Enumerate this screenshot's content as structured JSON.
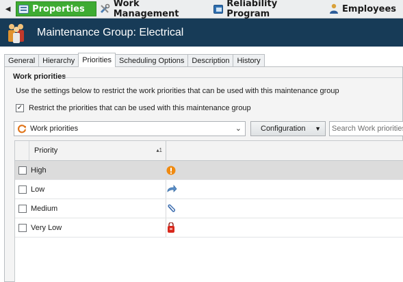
{
  "nav": {
    "items": [
      {
        "label": "Properties",
        "icon": "properties-icon",
        "active": true
      },
      {
        "label": "Work Management",
        "icon": "tools-icon"
      },
      {
        "label": "Reliability Program",
        "icon": "reliability-icon"
      },
      {
        "label": "Employees",
        "icon": "employee-icon"
      }
    ]
  },
  "header": {
    "title": "Maintenance Group: Electrical",
    "icon": "maintenance-group-icon"
  },
  "tabs": [
    "General",
    "Hierarchy",
    "Priorities",
    "Scheduling Options",
    "Description",
    "History"
  ],
  "active_tab": "Priorities",
  "section": {
    "title": "Work priorities",
    "description": "Use the settings below to restrict the work priorities that can be used with this maintenance group",
    "restrict_label": "Restrict the priorities that can be used with this maintenance group",
    "restrict_checked": true
  },
  "toolbar": {
    "view_value": "Work priorities",
    "configuration_label": "Configuration",
    "search_placeholder": "Search Work priorities"
  },
  "grid": {
    "column_header": "Priority",
    "sort_indicator": "1",
    "rows": [
      {
        "name": "High",
        "icon": "exclamation-icon",
        "selected": true,
        "checked": false
      },
      {
        "name": "Low",
        "icon": "arrow-icon",
        "selected": false,
        "checked": false
      },
      {
        "name": "Medium",
        "icon": "paperclip-icon",
        "selected": false,
        "checked": false
      },
      {
        "name": "Very Low",
        "icon": "bag-icon",
        "selected": false,
        "checked": false
      }
    ]
  },
  "colors": {
    "active_nav": "#3eab32",
    "header_bg": "#173b57",
    "selected_row": "#dcdcdc"
  }
}
